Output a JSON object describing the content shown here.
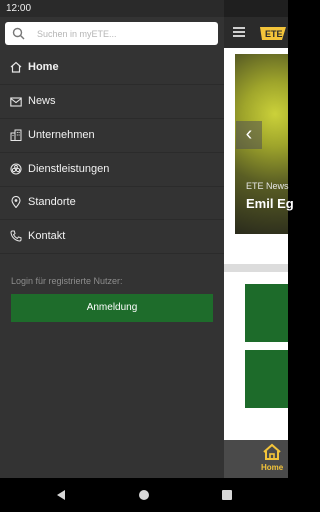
{
  "statusbar": {
    "time": "12:00"
  },
  "search": {
    "placeholder": "Suchen in myETE...",
    "icon": "search-icon"
  },
  "menu": {
    "items": [
      {
        "label": "Home",
        "icon": "home-icon",
        "active": true
      },
      {
        "label": "News",
        "icon": "mail-icon",
        "active": false
      },
      {
        "label": "Unternehmen",
        "icon": "building-icon",
        "active": false
      },
      {
        "label": "Dienstleistungen",
        "icon": "services-icon",
        "active": false
      },
      {
        "label": "Standorte",
        "icon": "location-pin-icon",
        "active": false
      },
      {
        "label": "Kontakt",
        "icon": "phone-icon",
        "active": false
      }
    ]
  },
  "login": {
    "hint": "Login für registrierte Nutzer:",
    "button_label": "Anmeldung"
  },
  "background_app": {
    "hero": {
      "category": "ETE News",
      "title": "Emil Eg"
    },
    "bottom_nav": {
      "home_label": "Home"
    }
  },
  "colors": {
    "drawer_bg": "#333333",
    "accent_green": "#1e6c2b",
    "accent_yellow": "#f3c43a"
  }
}
